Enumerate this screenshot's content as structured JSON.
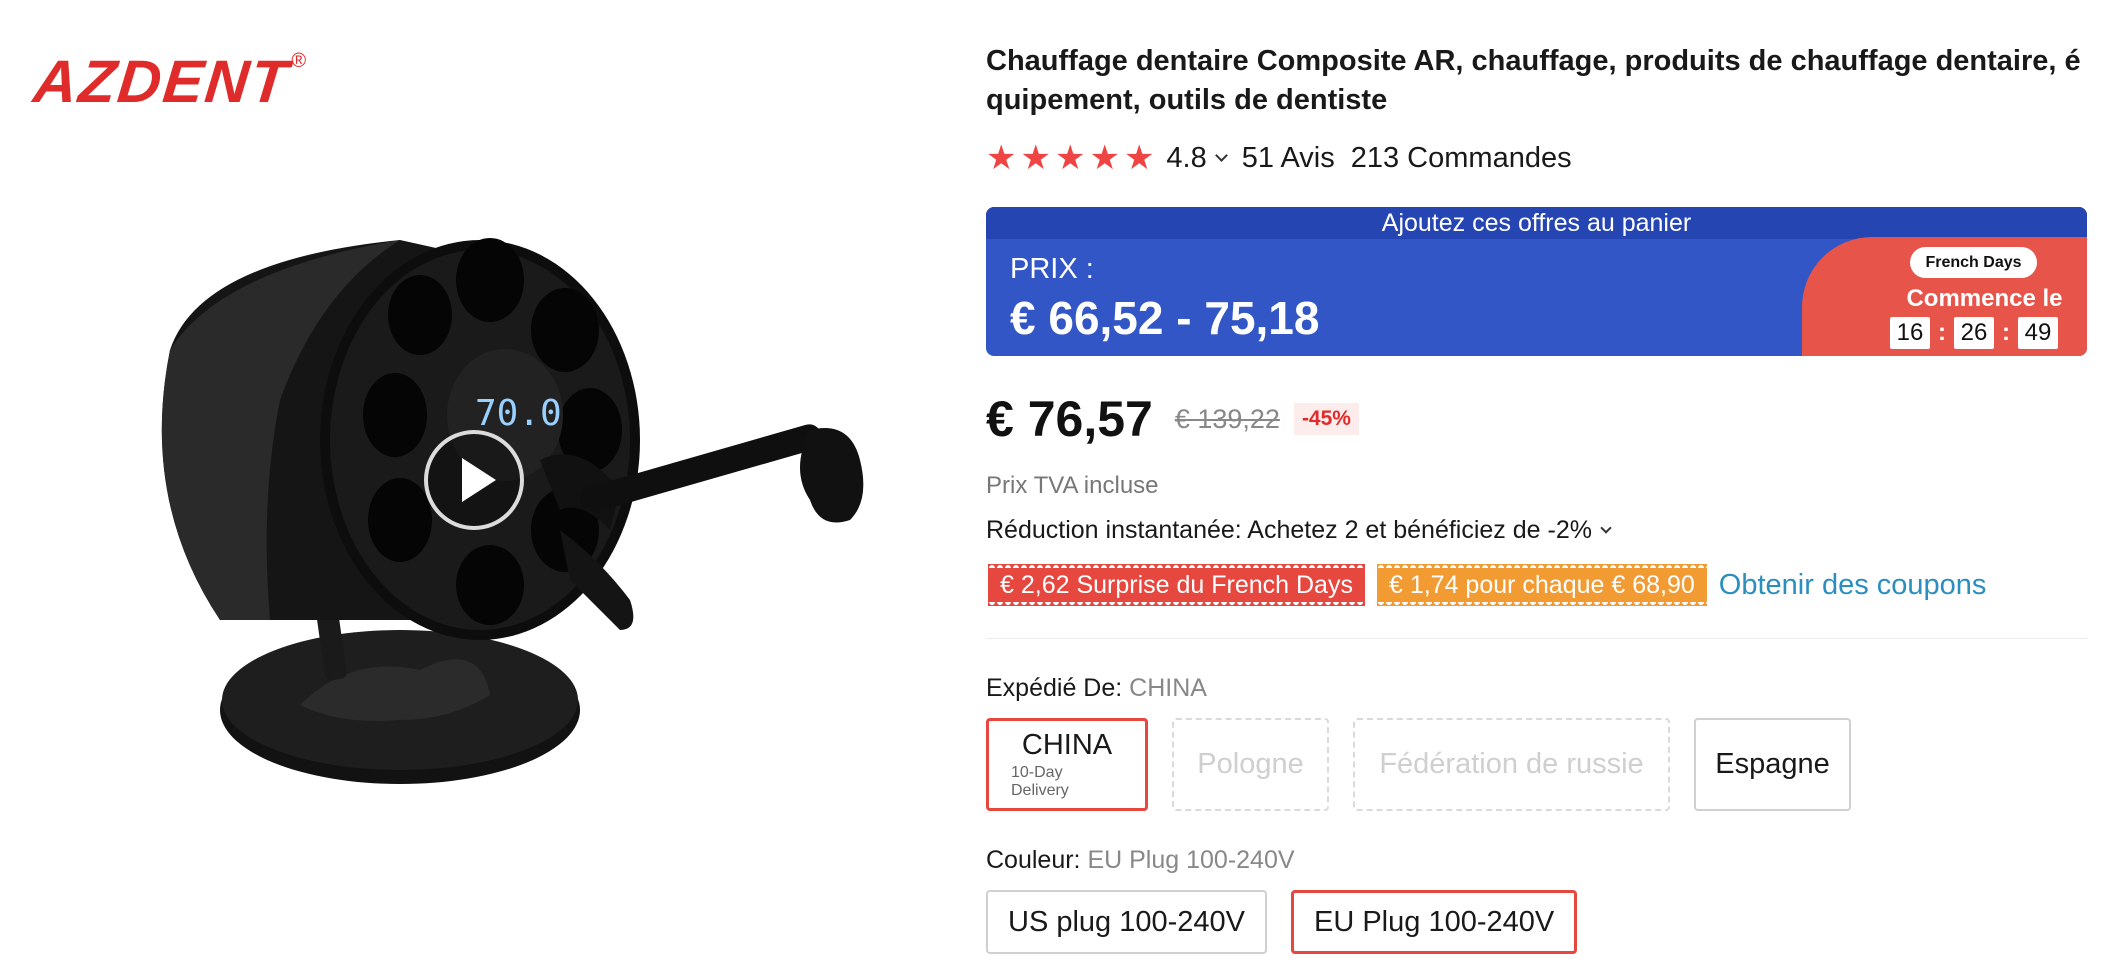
{
  "brand": {
    "name": "AZDENT",
    "reg": "®"
  },
  "product": {
    "title": "Chauffage dentaire Composite AR, chauffage, produits de chauffage dentaire, équipement, outils de dentiste",
    "display_reading": "70.0"
  },
  "rating": {
    "stars": 5,
    "value": "4.8",
    "reviews": "51 Avis",
    "orders": "213 Commandes"
  },
  "banner": {
    "header": "Ajoutez ces offres au panier",
    "price_label": "PRIX :",
    "price_range": "€ 66,52 - 75,18",
    "deal_badge": "French Days",
    "deal_starts": "Commence le",
    "countdown": {
      "h": "16",
      "m": "26",
      "s": "49"
    }
  },
  "price": {
    "current": "€ 76,57",
    "original": "€ 139,22",
    "discount": "-45%",
    "vat_note": "Prix TVA incluse"
  },
  "instant_discount": "Réduction instantanée: Achetez 2 et bénéficiez de -2%",
  "coupons": {
    "items": [
      "€ 2,62 Surprise du French Days",
      "€ 1,74 pour chaque € 68,90"
    ],
    "link": "Obtenir des coupons"
  },
  "shipping": {
    "label": "Expédié De:",
    "selected_value": "CHINA",
    "options": [
      {
        "label": "CHINA",
        "sub": "10-Day Delivery"
      },
      {
        "label": "Pologne"
      },
      {
        "label": "Fédération de russie"
      },
      {
        "label": "Espagne"
      }
    ]
  },
  "color": {
    "label": "Couleur:",
    "selected_value": "EU Plug 100-240V",
    "options": [
      "US plug 100-240V",
      "EU Plug 100-240V"
    ]
  },
  "colors": {
    "accent_red": "#e6483f",
    "banner_blue": "#3256c5",
    "coupon_orange": "#f39b33",
    "link_blue": "#2a8fbf",
    "star_red": "#ee4444"
  }
}
